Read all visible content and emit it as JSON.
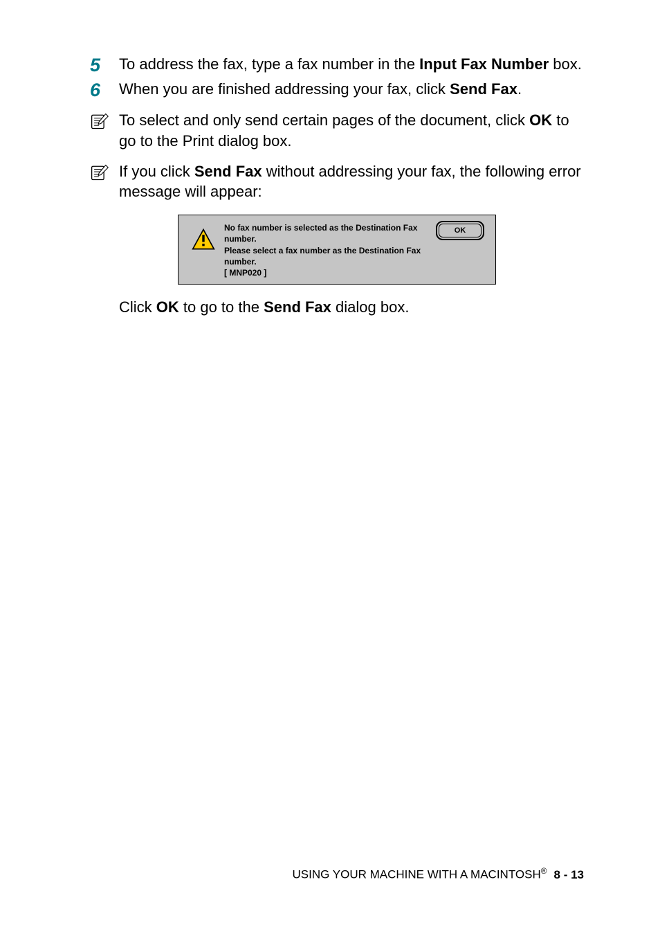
{
  "steps": [
    {
      "num": "5",
      "text_pre": "To address the fax, type a fax number in the ",
      "bold1": "Input Fax Number",
      "text_post": " box."
    },
    {
      "num": "6",
      "text_pre": "When you are finished addressing your fax, click ",
      "bold1": "Send Fax",
      "text_post": "."
    }
  ],
  "notes": [
    {
      "pre": "To select and only send certain pages of the document, click ",
      "bold1": "OK",
      "post": " to go to the Print dialog box."
    },
    {
      "pre": "If you click ",
      "bold1": "Send Fax",
      "post": " without addressing your fax, the following error message will appear:"
    }
  ],
  "dialog": {
    "message": "No fax number is selected as the Destination Fax number.\nPlease select a fax number as the Destination Fax number.\n[ MNP020 ]",
    "ok_label": "OK"
  },
  "after_dialog": {
    "pre": "Click ",
    "bold1": "OK",
    "mid": " to go to the ",
    "bold2": "Send Fax",
    "post": " dialog box."
  },
  "footer": {
    "text": "USING YOUR MACHINE WITH A MACINTOSH",
    "superscript": "®",
    "page": "8 - 13"
  }
}
